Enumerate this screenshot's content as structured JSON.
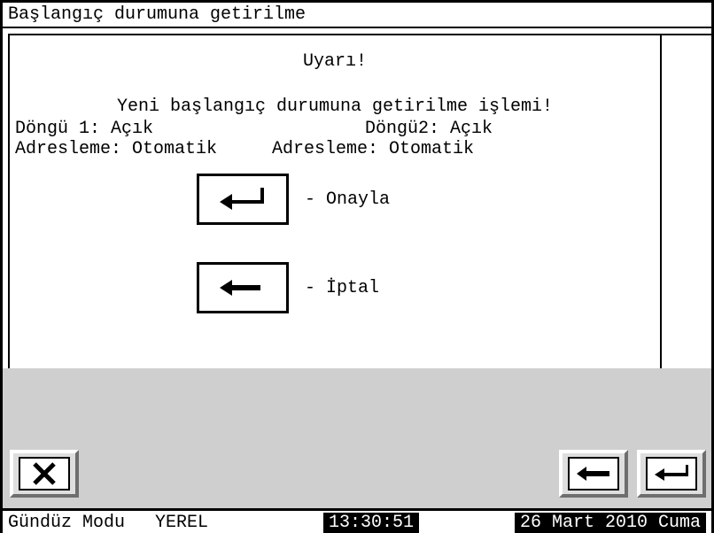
{
  "title": "Başlangıç durumuna getirilme",
  "warning": "Uyarı!",
  "subtitle": "Yeni başlangıç durumuna getirilme işlemi!",
  "left": {
    "loop_label": "Döngü 1:",
    "loop_value": "Açık",
    "addr_label": "Adresleme:",
    "addr_value": "Otomatik"
  },
  "right": {
    "loop_label": "Döngü2:",
    "loop_value": "Açık",
    "addr_label": "Adresleme:",
    "addr_value": "Otomatik"
  },
  "actions": {
    "confirm": "- Onayla",
    "cancel": "- İptal"
  },
  "status": {
    "mode": "Gündüz Modu",
    "local": "YEREL",
    "time": "13:30:51",
    "date": "26 Mart 2010 Cuma"
  }
}
